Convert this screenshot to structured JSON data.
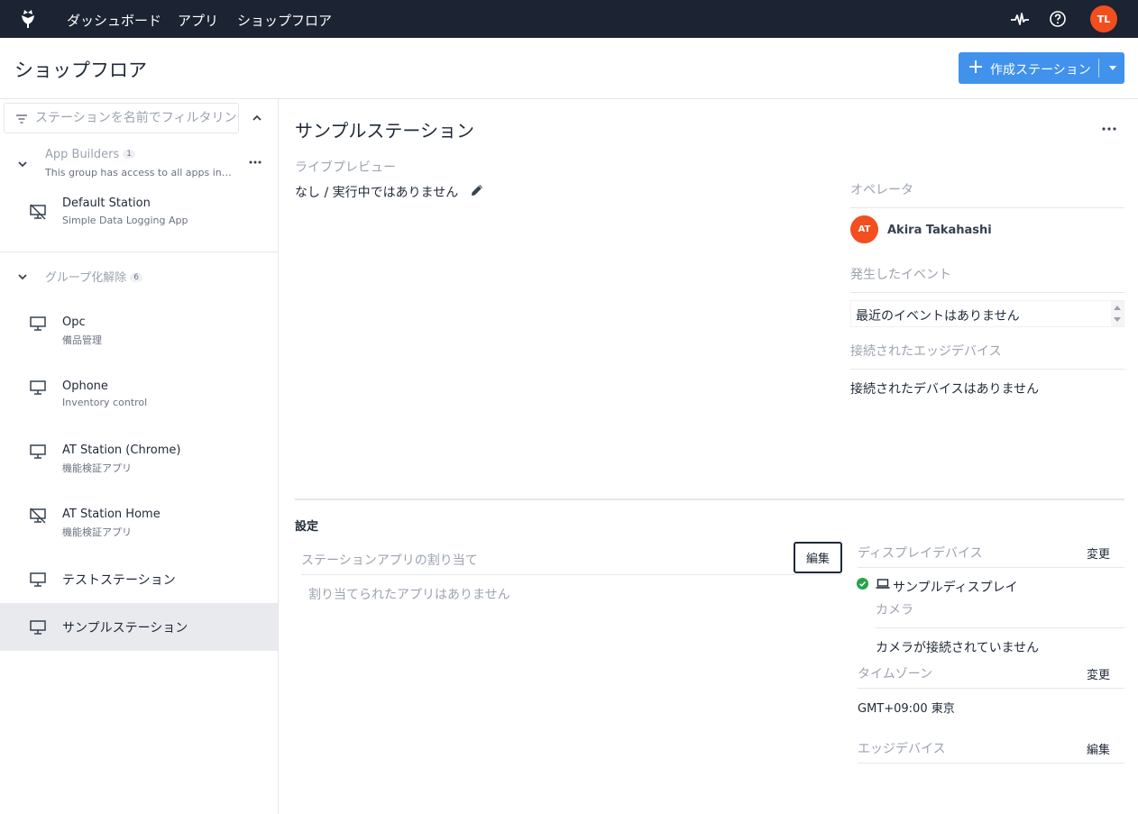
{
  "nav": {
    "links": [
      "ダッシュボード",
      "アプリ",
      "ショップフロア"
    ],
    "user_initials": "TL",
    "icons": [
      "tulip-logo-icon",
      "activity-pulse-icon",
      "help-circle-icon"
    ]
  },
  "header": {
    "title": "ショップフロア",
    "create_button": "作成ステーション"
  },
  "sidebar": {
    "filter_placeholder": "ステーションを名前でフィルタリング",
    "groups": [
      {
        "name": "App Builders",
        "count": "1",
        "description": "This group has access to all apps in t...",
        "stations": [
          {
            "name": "Default Station",
            "sub": "Simple Data Logging App",
            "icon": "display-off-icon"
          }
        ]
      },
      {
        "name": "グループ化解除",
        "count": "6",
        "stations": [
          {
            "name": "Opc",
            "sub": "備品管理",
            "icon": "monitor-icon"
          },
          {
            "name": "Ophone",
            "sub": "Inventory control",
            "icon": "monitor-icon"
          },
          {
            "name": "AT Station (Chrome)",
            "sub": "機能検証アプリ",
            "icon": "monitor-icon"
          },
          {
            "name": "AT Station Home",
            "sub": "機能検証アプリ",
            "icon": "display-off-icon"
          },
          {
            "name": "テストステーション",
            "sub": "",
            "icon": "monitor-icon"
          },
          {
            "name": "サンプルステーション",
            "sub": "",
            "icon": "monitor-icon",
            "active": true
          }
        ]
      }
    ]
  },
  "main": {
    "title": "サンプルステーション",
    "live_preview_label": "ライブプレビュー",
    "live_preview_value": "なし / 実行中ではありません",
    "operator_label": "オペレータ",
    "operator_initials": "AT",
    "operator_name": "Akira Takahashi",
    "events_label": "発生したイベント",
    "events_value": "最近のイベントはありません",
    "edge_label": "接続されたエッジデバイス",
    "edge_value": "接続されたデバイスはありません",
    "settings_title": "設定",
    "app_assign_label": "ステーションアプリの割り当て",
    "app_assign_edit": "編集",
    "app_assign_value": "割り当てられたアプリはありません",
    "display_label": "ディスプレイデバイス",
    "display_change": "変更",
    "display_name": "サンプルディスプレイ",
    "camera_label": "カメラ",
    "camera_value": "カメラが接続されていません",
    "timezone_label": "タイムゾーン",
    "timezone_change": "変更",
    "timezone_value": "GMT+09:00 東京",
    "edge_device_label": "エッジデバイス",
    "edge_device_edit": "編集"
  },
  "colors": {
    "nav_bg": "#1c2333",
    "accent": "#4192ec",
    "avatar": "#f24e1e",
    "success": "#22a447",
    "active_row": "#e9eaee"
  }
}
